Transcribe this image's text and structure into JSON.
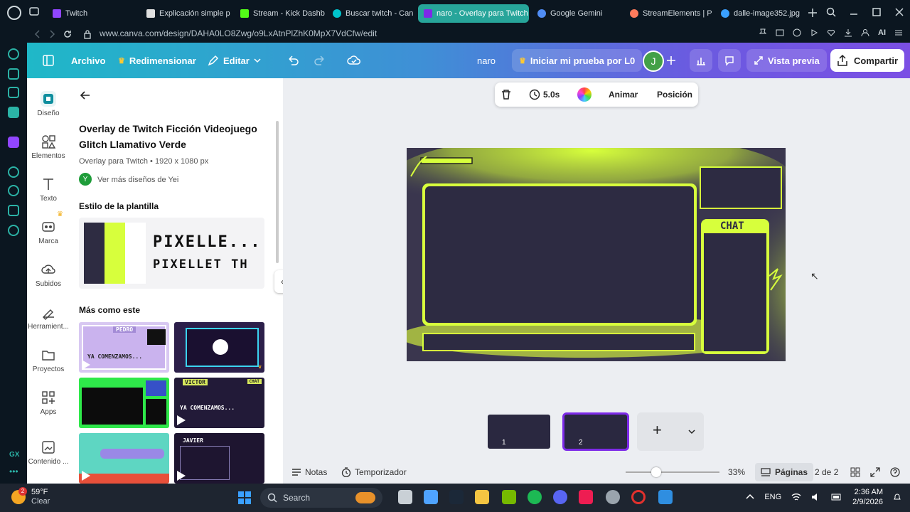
{
  "browser": {
    "tabs": [
      {
        "label": "Twitch",
        "color": "#9146ff"
      },
      {
        "label": "Explicación simple p",
        "color": "#e0e0e0"
      },
      {
        "label": "Stream - Kick Dashb",
        "color": "#53fc18"
      },
      {
        "label": "Buscar twitch - Can",
        "color": "#00c4cc"
      },
      {
        "label": "naro - Overlay para Twitch",
        "color": "#7d2ae8",
        "active": true
      },
      {
        "label": "Google Gemini",
        "color": "#4f8df5"
      },
      {
        "label": "StreamElements | P",
        "color": "#ff7b5c"
      },
      {
        "label": "dalle-image352.jpg",
        "color": "#3aa0ff"
      }
    ],
    "url": "www.canva.com/design/DAHA0LO8Zwg/o9LxAtnPlZhK0MpX7VdCfw/edit",
    "ai_label": "AI",
    "gx_label": "GX"
  },
  "header": {
    "file": "Archivo",
    "resize": "Redimensionar",
    "edit": "Editar",
    "design_name": "naro",
    "trial": "Iniciar mi prueba por L0",
    "avatar_initial": "J",
    "preview": "Vista previa",
    "share": "Compartir"
  },
  "rail": {
    "items": [
      {
        "label": "Diseño",
        "icon": "design-icon"
      },
      {
        "label": "Elementos",
        "icon": "elements-icon"
      },
      {
        "label": "Texto",
        "icon": "text-icon"
      },
      {
        "label": "Marca",
        "icon": "brand-icon"
      },
      {
        "label": "Subidos",
        "icon": "upload-icon"
      },
      {
        "label": "Herramient...",
        "icon": "tools-icon"
      },
      {
        "label": "Proyectos",
        "icon": "folder-icon"
      },
      {
        "label": "Apps",
        "icon": "apps-icon"
      },
      {
        "label": "Contenido ...",
        "icon": "content-icon"
      }
    ]
  },
  "panel": {
    "title": "Overlay de Twitch Ficción Videojuego Glitch Llamativo Verde",
    "subtitle": "Overlay para Twitch • 1920 x 1080 px",
    "author_initial": "Y",
    "author_link": "Ver más diseños de Yei",
    "style_heading": "Estilo de la plantilla",
    "style_colors": [
      "#2e2c42",
      "#d7ff3c",
      "#ffffff"
    ],
    "font_sample_1": "PIXELLE...",
    "font_sample_2": "PIXELLET TH",
    "more_heading": "Más como este",
    "thumb_labels": [
      "PEDRO",
      "YA COMENZAMOS...",
      "VICTOR",
      "YA COMENZAMOS...",
      "JAVIER",
      "CHAT"
    ]
  },
  "toolbar": {
    "duration": "5.0s",
    "animate": "Animar",
    "position": "Posición"
  },
  "canvas": {
    "chat_label": "CHAT",
    "accent": "#d7ff3c",
    "bg": "#2a2840"
  },
  "pages": {
    "page1": "1",
    "page2": "2",
    "add": "+"
  },
  "bottom": {
    "notes": "Notas",
    "timer": "Temporizador",
    "zoom": "33%",
    "pages": "Páginas",
    "page_count": "2 de 2"
  },
  "taskbar": {
    "temp": "59°F",
    "weather": "Clear",
    "weather_badge": "2",
    "search": "Search",
    "lang": "ENG",
    "time": "2:36 AM",
    "date": "2/9/2026"
  }
}
